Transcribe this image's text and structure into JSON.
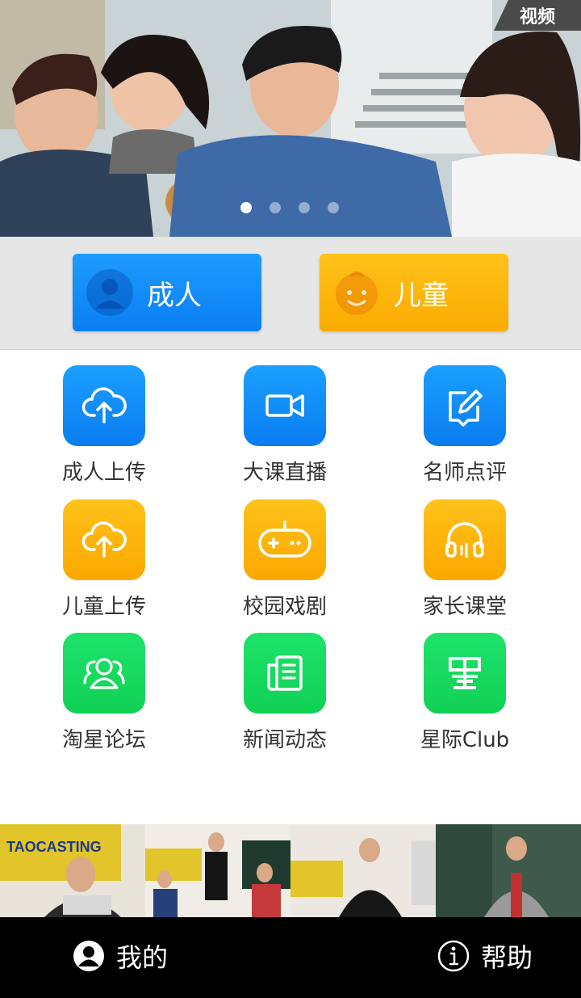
{
  "banner": {
    "tag_label": "视频",
    "slide_count": 4,
    "active_slide": 1
  },
  "categories": [
    {
      "label": "成人",
      "icon": "person-icon",
      "color": "#0a86f5"
    },
    {
      "label": "儿童",
      "icon": "child-face-icon",
      "color": "#fbb000"
    }
  ],
  "grid": [
    {
      "label": "成人上传",
      "icon": "upload-cloud-icon",
      "color": "blue"
    },
    {
      "label": "大课直播",
      "icon": "video-camera-icon",
      "color": "blue"
    },
    {
      "label": "名师点评",
      "icon": "edit-note-icon",
      "color": "blue"
    },
    {
      "label": "儿童上传",
      "icon": "upload-cloud-icon",
      "color": "orange"
    },
    {
      "label": "校园戏剧",
      "icon": "gamepad-icon",
      "color": "orange"
    },
    {
      "label": "家长课堂",
      "icon": "headphones-icon",
      "color": "orange"
    },
    {
      "label": "淘星论坛",
      "icon": "forum-users-icon",
      "color": "green"
    },
    {
      "label": "新闻动态",
      "icon": "newspaper-icon",
      "color": "green"
    },
    {
      "label": "星际Club",
      "icon": "star-club-logo-icon",
      "color": "green"
    }
  ],
  "strip": {
    "thumb_count": 4,
    "logo_text": "TAOCASTING"
  },
  "bottom_nav": {
    "mine_label": "我的",
    "help_label": "帮助"
  },
  "colors": {
    "blue": "#0a86f5",
    "orange": "#fbb000",
    "green": "#14d95c",
    "band": "#e6e6e6"
  }
}
